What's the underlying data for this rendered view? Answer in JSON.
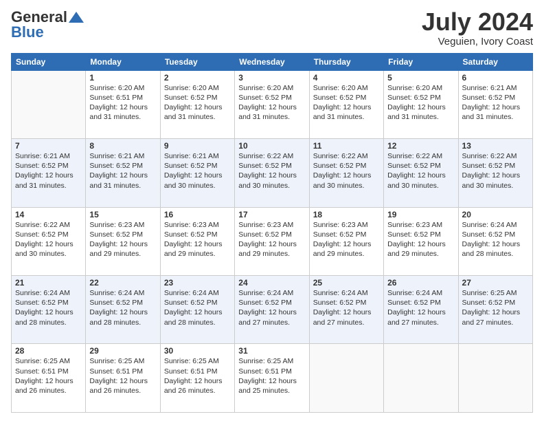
{
  "header": {
    "logo_general": "General",
    "logo_blue": "Blue",
    "month_title": "July 2024",
    "location": "Veguien, Ivory Coast"
  },
  "days_of_week": [
    "Sunday",
    "Monday",
    "Tuesday",
    "Wednesday",
    "Thursday",
    "Friday",
    "Saturday"
  ],
  "weeks": [
    [
      {
        "day": "",
        "info": ""
      },
      {
        "day": "1",
        "info": "Sunrise: 6:20 AM\nSunset: 6:51 PM\nDaylight: 12 hours\nand 31 minutes."
      },
      {
        "day": "2",
        "info": "Sunrise: 6:20 AM\nSunset: 6:52 PM\nDaylight: 12 hours\nand 31 minutes."
      },
      {
        "day": "3",
        "info": "Sunrise: 6:20 AM\nSunset: 6:52 PM\nDaylight: 12 hours\nand 31 minutes."
      },
      {
        "day": "4",
        "info": "Sunrise: 6:20 AM\nSunset: 6:52 PM\nDaylight: 12 hours\nand 31 minutes."
      },
      {
        "day": "5",
        "info": "Sunrise: 6:20 AM\nSunset: 6:52 PM\nDaylight: 12 hours\nand 31 minutes."
      },
      {
        "day": "6",
        "info": "Sunrise: 6:21 AM\nSunset: 6:52 PM\nDaylight: 12 hours\nand 31 minutes."
      }
    ],
    [
      {
        "day": "7",
        "info": "Sunrise: 6:21 AM\nSunset: 6:52 PM\nDaylight: 12 hours\nand 31 minutes."
      },
      {
        "day": "8",
        "info": "Sunrise: 6:21 AM\nSunset: 6:52 PM\nDaylight: 12 hours\nand 31 minutes."
      },
      {
        "day": "9",
        "info": "Sunrise: 6:21 AM\nSunset: 6:52 PM\nDaylight: 12 hours\nand 30 minutes."
      },
      {
        "day": "10",
        "info": "Sunrise: 6:22 AM\nSunset: 6:52 PM\nDaylight: 12 hours\nand 30 minutes."
      },
      {
        "day": "11",
        "info": "Sunrise: 6:22 AM\nSunset: 6:52 PM\nDaylight: 12 hours\nand 30 minutes."
      },
      {
        "day": "12",
        "info": "Sunrise: 6:22 AM\nSunset: 6:52 PM\nDaylight: 12 hours\nand 30 minutes."
      },
      {
        "day": "13",
        "info": "Sunrise: 6:22 AM\nSunset: 6:52 PM\nDaylight: 12 hours\nand 30 minutes."
      }
    ],
    [
      {
        "day": "14",
        "info": "Sunrise: 6:22 AM\nSunset: 6:52 PM\nDaylight: 12 hours\nand 30 minutes."
      },
      {
        "day": "15",
        "info": "Sunrise: 6:23 AM\nSunset: 6:52 PM\nDaylight: 12 hours\nand 29 minutes."
      },
      {
        "day": "16",
        "info": "Sunrise: 6:23 AM\nSunset: 6:52 PM\nDaylight: 12 hours\nand 29 minutes."
      },
      {
        "day": "17",
        "info": "Sunrise: 6:23 AM\nSunset: 6:52 PM\nDaylight: 12 hours\nand 29 minutes."
      },
      {
        "day": "18",
        "info": "Sunrise: 6:23 AM\nSunset: 6:52 PM\nDaylight: 12 hours\nand 29 minutes."
      },
      {
        "day": "19",
        "info": "Sunrise: 6:23 AM\nSunset: 6:52 PM\nDaylight: 12 hours\nand 29 minutes."
      },
      {
        "day": "20",
        "info": "Sunrise: 6:24 AM\nSunset: 6:52 PM\nDaylight: 12 hours\nand 28 minutes."
      }
    ],
    [
      {
        "day": "21",
        "info": "Sunrise: 6:24 AM\nSunset: 6:52 PM\nDaylight: 12 hours\nand 28 minutes."
      },
      {
        "day": "22",
        "info": "Sunrise: 6:24 AM\nSunset: 6:52 PM\nDaylight: 12 hours\nand 28 minutes."
      },
      {
        "day": "23",
        "info": "Sunrise: 6:24 AM\nSunset: 6:52 PM\nDaylight: 12 hours\nand 28 minutes."
      },
      {
        "day": "24",
        "info": "Sunrise: 6:24 AM\nSunset: 6:52 PM\nDaylight: 12 hours\nand 27 minutes."
      },
      {
        "day": "25",
        "info": "Sunrise: 6:24 AM\nSunset: 6:52 PM\nDaylight: 12 hours\nand 27 minutes."
      },
      {
        "day": "26",
        "info": "Sunrise: 6:24 AM\nSunset: 6:52 PM\nDaylight: 12 hours\nand 27 minutes."
      },
      {
        "day": "27",
        "info": "Sunrise: 6:25 AM\nSunset: 6:52 PM\nDaylight: 12 hours\nand 27 minutes."
      }
    ],
    [
      {
        "day": "28",
        "info": "Sunrise: 6:25 AM\nSunset: 6:51 PM\nDaylight: 12 hours\nand 26 minutes."
      },
      {
        "day": "29",
        "info": "Sunrise: 6:25 AM\nSunset: 6:51 PM\nDaylight: 12 hours\nand 26 minutes."
      },
      {
        "day": "30",
        "info": "Sunrise: 6:25 AM\nSunset: 6:51 PM\nDaylight: 12 hours\nand 26 minutes."
      },
      {
        "day": "31",
        "info": "Sunrise: 6:25 AM\nSunset: 6:51 PM\nDaylight: 12 hours\nand 25 minutes."
      },
      {
        "day": "",
        "info": ""
      },
      {
        "day": "",
        "info": ""
      },
      {
        "day": "",
        "info": ""
      }
    ]
  ]
}
